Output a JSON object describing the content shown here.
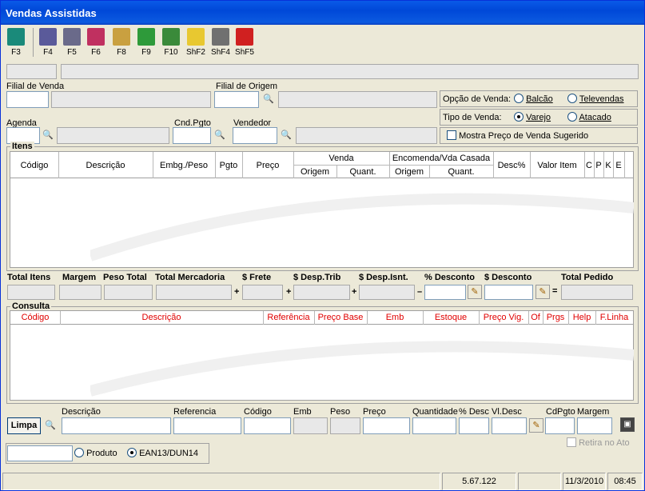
{
  "window": {
    "title": "Vendas Assistidas"
  },
  "toolbar": [
    {
      "key": "F3",
      "icon": "exit-door-icon",
      "color": "#1a8a7a"
    },
    {
      "key": "F4",
      "icon": "document-icon",
      "color": "#5a5a9a"
    },
    {
      "key": "F5",
      "icon": "copy-pages-icon",
      "color": "#6a6a8a"
    },
    {
      "key": "F6",
      "icon": "eraser-icon",
      "color": "#c03060"
    },
    {
      "key": "F8",
      "icon": "key-icon",
      "color": "#c9a040"
    },
    {
      "key": "F9",
      "icon": "money-icon",
      "color": "#2e9a3a"
    },
    {
      "key": "F10",
      "icon": "chart-icon",
      "color": "#3a8a3a"
    },
    {
      "key": "ShF2",
      "icon": "lightbulb-icon",
      "color": "#e8c830"
    },
    {
      "key": "ShF4",
      "icon": "trash-icon",
      "color": "#707070"
    },
    {
      "key": "ShF5",
      "icon": "telephone-icon",
      "color": "#d02020"
    }
  ],
  "header": {
    "filial_venda": "Filial de Venda",
    "filial_origem": "Filial de Origem",
    "opcao_venda": "Opção de Venda:",
    "balcao": "Balcão",
    "televendas": "Televendas",
    "tipo_venda": "Tipo de Venda:",
    "varejo": "Varejo",
    "atacado": "Atacado",
    "mostra_preco": "Mostra Preço de Venda Sugerido",
    "agenda": "Agenda",
    "cnd_pgto": "Cnd.Pgto",
    "vendedor": "Vendedor"
  },
  "itens": {
    "title": "Itens",
    "columns": [
      "Código",
      "Descrição",
      "Embg./Peso",
      "Pgto",
      "Preço",
      "Venda",
      "Encomenda/Vda Casada",
      "Desc%",
      "Valor Item",
      "C",
      "P",
      "K",
      "E"
    ],
    "sub": [
      "Origem",
      "Quant.",
      "Origem",
      "Quant."
    ]
  },
  "totals": {
    "labels": [
      "Total Itens",
      "Margem",
      "Peso Total",
      "Total Mercadoria",
      "$ Frete",
      "$ Desp.Trib",
      "$ Desp.Isnt.",
      "% Desconto",
      "$ Desconto",
      "Total Pedido"
    ],
    "ops": [
      "+",
      "+",
      "+",
      "–",
      "="
    ]
  },
  "consulta": {
    "title": "Consulta",
    "columns": [
      "Código",
      "Descrição",
      "Referência",
      "Preço Base",
      "Emb",
      "Estoque",
      "Preço Vig.",
      "Of",
      "Prgs",
      "Help",
      "F.Linha"
    ]
  },
  "bottom": {
    "limpa": "Limpa",
    "labels": [
      "Descrição",
      "Referencia",
      "Código",
      "Emb",
      "Peso",
      "Preço",
      "Quantidade",
      "% Desc",
      "Vl.Desc",
      "CdPgto",
      "Margem"
    ],
    "retira": "Retira no Ato",
    "produto": "Produto",
    "ean": "EAN13/DUN14"
  },
  "status": {
    "version": "5.67.122",
    "date": "11/3/2010",
    "time": "08:45"
  }
}
